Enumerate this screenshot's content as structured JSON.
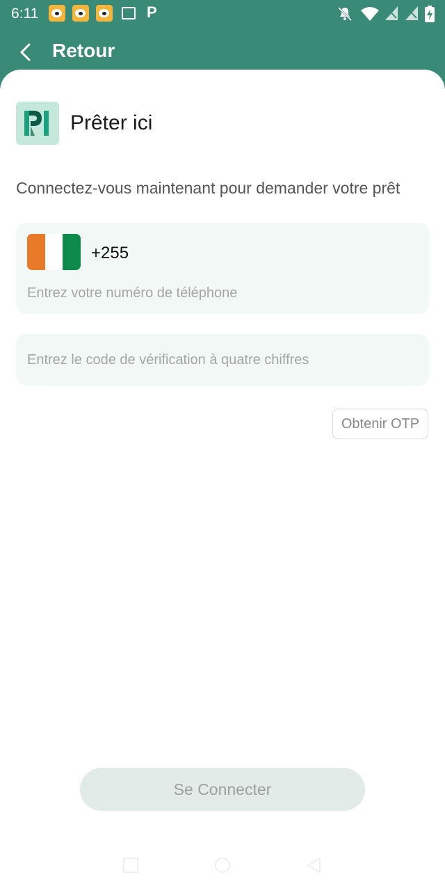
{
  "status_bar": {
    "time": "6:11",
    "notification_icons": [
      "weibo-icon",
      "weibo-icon",
      "weibo-icon",
      "gallery-icon",
      "p-icon"
    ],
    "p_glyph": "P",
    "system_icons": [
      "bell-off-icon",
      "wifi-icon",
      "signal-icon",
      "signal-icon",
      "battery-charging-icon"
    ]
  },
  "app_bar": {
    "back_icon": "chevron-left-icon",
    "title": "Retour"
  },
  "brand": {
    "logo_icon": "pi-logo-icon",
    "name": "Prêter ici"
  },
  "login": {
    "subtitle": "Connectez-vous maintenant pour demander votre prêt",
    "country_flag_colors": [
      "#e87a2a",
      "#ffffff",
      "#0e8a4a"
    ],
    "country_code": "+255",
    "phone_placeholder": "Entrez votre numéro de téléphone",
    "otp_placeholder": "Entrez le code de vérification à quatre chiffres",
    "get_otp_label": "Obtenir OTP",
    "submit_label": "Se Connecter"
  },
  "colors": {
    "header_bg": "#3a8a78",
    "logo_bg": "#c5e8dd",
    "input_bg": "#f2f8f6",
    "button_disabled_bg": "#e2ebe8"
  }
}
